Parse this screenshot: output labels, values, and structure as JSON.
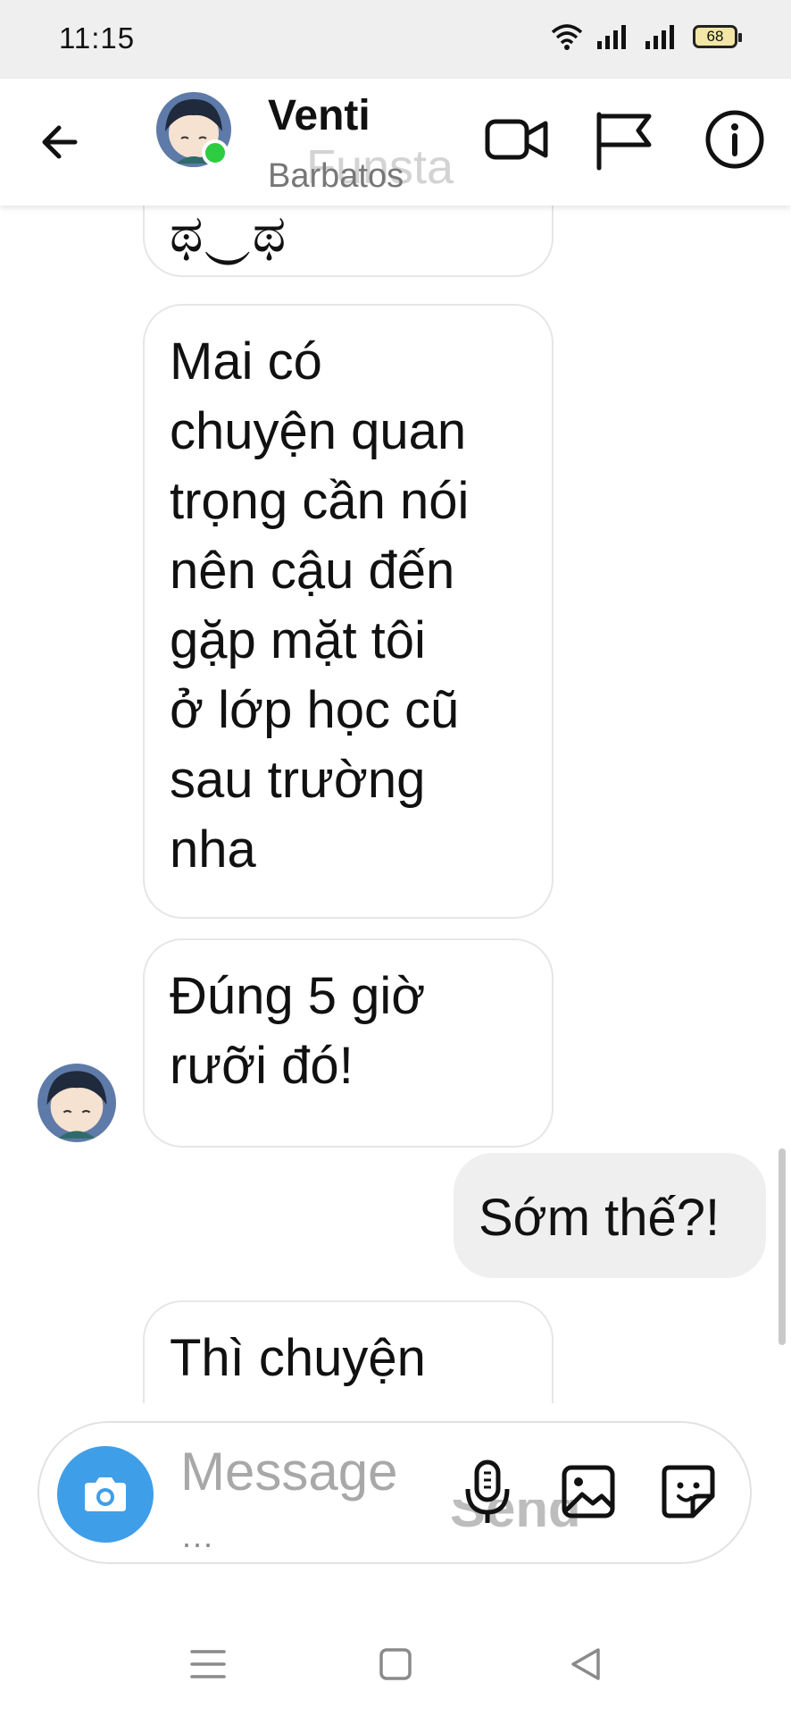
{
  "status_bar": {
    "time": "11:15",
    "battery": "68"
  },
  "header": {
    "contact_name": "Venti",
    "contact_subtitle": "Barbatos",
    "watermark": "Funsta"
  },
  "messages": [
    {
      "direction": "incoming",
      "text": "ಥ‿ಥ"
    },
    {
      "direction": "incoming",
      "lines": [
        "Mai có",
        "chuyện quan",
        "trọng cần nói",
        "nên cậu đến",
        "gặp mặt tôi",
        "ở lớp học cũ",
        "sau trường",
        "nha"
      ]
    },
    {
      "direction": "incoming",
      "lines": [
        "Đúng 5 giờ",
        "rưỡi đó!"
      ]
    },
    {
      "direction": "outgoing",
      "text": "Sớm thế?!"
    },
    {
      "direction": "incoming",
      "text": "Thì chuyện"
    }
  ],
  "composer": {
    "placeholder": "Message",
    "ellipsis": "...",
    "ghost_text": "Send"
  },
  "colors": {
    "accent_blue": "#3f9ee8",
    "online_green": "#2ecc40",
    "outgoing_bubble": "#efefef"
  }
}
